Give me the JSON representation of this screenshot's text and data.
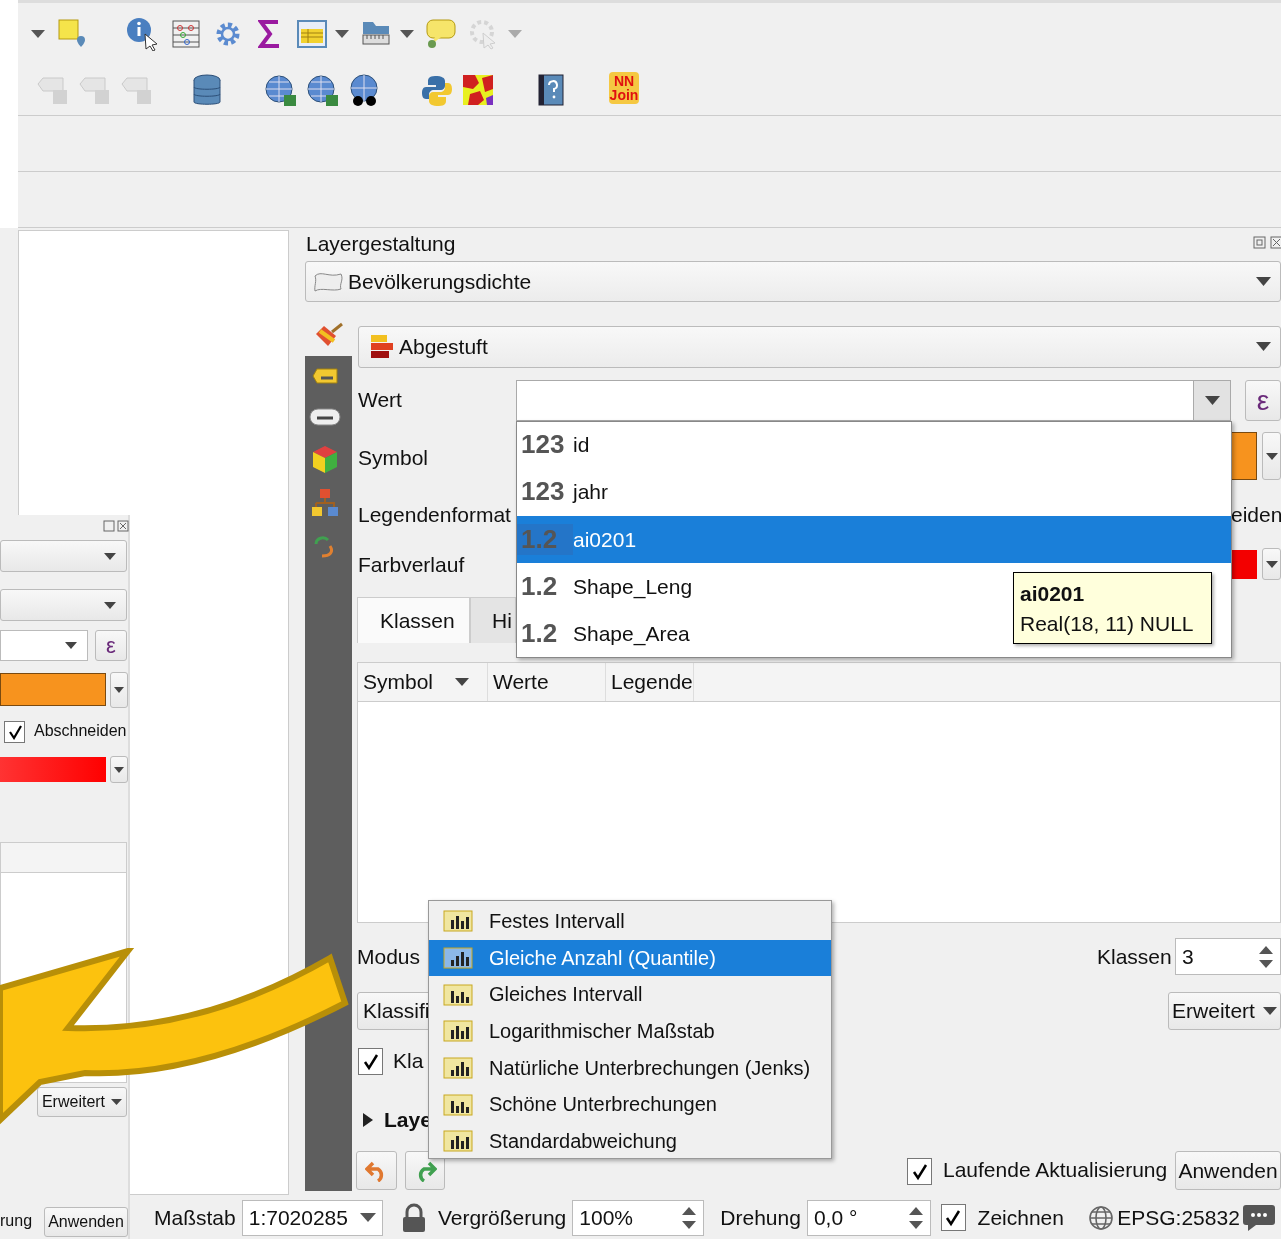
{
  "toolbar_plugin": {
    "lines": [
      "NN",
      "Join"
    ]
  },
  "left_panel": {
    "expression_button": "ε",
    "clip_checkbox": {
      "label": "Abschneiden",
      "checked": true
    },
    "advanced_button": "Erweitert",
    "status_text": "rung",
    "apply_button": "Anwenden"
  },
  "dock": {
    "title": "Layergestaltung",
    "layer": "Bevölkerungsdichte",
    "renderer": "Abgestuft",
    "labels": [
      "Wert",
      "Symbol",
      "Legendenformat",
      "Farbverlauf"
    ],
    "expression_button": "ε",
    "cut_label": "eiden",
    "tabs": [
      {
        "label": "Klassen",
        "selected": true
      },
      {
        "label": "Hi",
        "selected": false
      }
    ],
    "table": {
      "columns": [
        "Symbol",
        "Werte",
        "Legende"
      ]
    },
    "mode_label": "Modus",
    "classes_label": "Klassen",
    "classes_value": "3",
    "classify_button": "Klassifi",
    "advanced_button": "Erweitert",
    "link_checkbox": {
      "label": "Kla",
      "checked": true
    },
    "section": {
      "label": "Laye",
      "expanded": false
    },
    "live_update": {
      "label": "Laufende Aktualisierung",
      "checked": true
    },
    "apply_button": "Anwenden"
  },
  "field_dropdown": {
    "items": [
      {
        "type": "123",
        "name": "id",
        "selected": false
      },
      {
        "type": "123",
        "name": "jahr",
        "selected": false
      },
      {
        "type": "1.2",
        "name": "ai0201",
        "selected": true
      },
      {
        "type": "1.2",
        "name": "Shape_Leng",
        "selected": false
      },
      {
        "type": "1.2",
        "name": "Shape_Area",
        "selected": false
      }
    ]
  },
  "tooltip": {
    "title": "ai0201",
    "text": "Real(18, 11) NULL"
  },
  "mode_menu": {
    "items": [
      {
        "label": "Festes Intervall",
        "selected": false
      },
      {
        "label": "Gleiche Anzahl (Quantile)",
        "selected": true
      },
      {
        "label": "Gleiches Intervall",
        "selected": false
      },
      {
        "label": "Logarithmischer Maßstab",
        "selected": false
      },
      {
        "label": "Natürliche Unterbrechungen (Jenks)",
        "selected": false
      },
      {
        "label": "Schöne Unterbrechungen",
        "selected": false
      },
      {
        "label": "Standardabweichung",
        "selected": false
      }
    ]
  },
  "status_bar": {
    "scale_label": "Maßstab",
    "scale": "1:7020285",
    "magnifier_label": "Vergrößerung",
    "magnifier": "100%",
    "rotation_label": "Drehung",
    "rotation": "0,0 °",
    "render": {
      "label": "Zeichnen",
      "checked": true
    },
    "crs": "EPSG:25832"
  }
}
